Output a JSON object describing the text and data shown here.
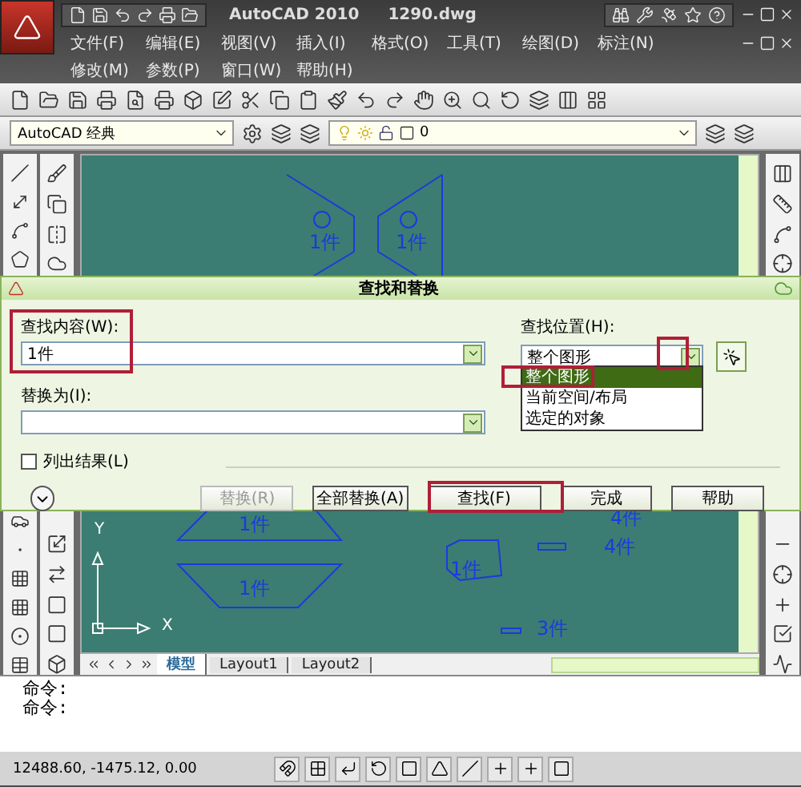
{
  "title_bar": {
    "title": "AutoCAD 2010",
    "file": "1290.dwg"
  },
  "menu_rows": [
    [
      "文件(F)",
      "编辑(E)",
      "视图(V)",
      "插入(I)",
      "格式(O)",
      "工具(T)",
      "绘图(D)",
      "标注(N)"
    ],
    [
      "修改(M)",
      "参数(P)",
      "窗口(W)",
      "帮助(H)"
    ]
  ],
  "workspace": {
    "value": "AutoCAD 经典"
  },
  "layer": {
    "value": "0"
  },
  "canvas": {
    "axes": [
      "Y",
      "X"
    ],
    "labels": [
      "1件",
      "1件",
      "1件",
      "4件",
      "4件",
      "1件",
      "1件",
      "3件"
    ]
  },
  "layout_tabs": [
    {
      "label": "模型",
      "selected": true
    },
    {
      "label": "Layout1",
      "selected": false
    },
    {
      "label": "Layout2",
      "selected": false
    }
  ],
  "command_lines": [
    "命令:",
    "命令:"
  ],
  "status_bar": {
    "coordinates": "12488.60, -1475.12, 0.00"
  },
  "dialog": {
    "title": "查找和替换",
    "find": {
      "label": "查找内容(W):",
      "value": "1件"
    },
    "replace": {
      "label": "替换为(I):"
    },
    "location": {
      "label": "查找位置(H):",
      "value": "整个图形",
      "expanded": true,
      "options": [
        {
          "label": "整个图形",
          "selected": true
        },
        {
          "label": "当前空间/布局",
          "selected": false
        },
        {
          "label": "选定的对象",
          "selected": false
        }
      ]
    },
    "list_results": {
      "label": "列出结果(L)",
      "checked": false
    },
    "buttons": [
      {
        "label": "替换(R)",
        "disabled": true
      },
      {
        "label": "全部替换(A)",
        "disabled": false
      },
      {
        "label": "查找(F)",
        "disabled": false
      },
      {
        "label": "完成",
        "disabled": false
      },
      {
        "label": "帮助",
        "disabled": false
      }
    ]
  }
}
